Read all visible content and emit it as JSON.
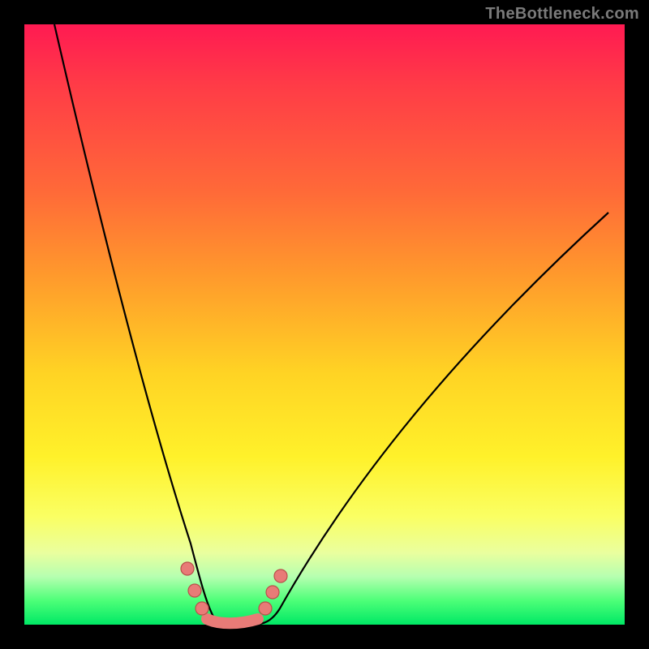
{
  "watermark": "TheBottleneck.com",
  "colors": {
    "page_bg": "#000000",
    "gradient_stops": [
      "#ff1a52",
      "#ff3b47",
      "#ff6a38",
      "#ff9a2c",
      "#ffd324",
      "#fff12a",
      "#faff63",
      "#eaff9e",
      "#b6ffb0",
      "#4dff78",
      "#00e865"
    ],
    "curve_stroke": "#000000",
    "bead_fill": "#e87b77",
    "bead_stroke": "#b94f4a",
    "watermark_text": "#7a7a7a"
  },
  "chart_data": {
    "type": "line",
    "title": "",
    "xlabel": "",
    "ylabel": "",
    "xlim": [
      0,
      100
    ],
    "ylim": [
      0,
      100
    ],
    "grid": false,
    "legend": false,
    "series": [
      {
        "name": "left-branch",
        "x": [
          5,
          8,
          11,
          14,
          17,
          20,
          23,
          25,
          27,
          29,
          31
        ],
        "y": [
          100,
          82,
          66,
          51,
          38,
          27,
          18,
          12,
          7,
          3,
          0
        ]
      },
      {
        "name": "valley-floor",
        "x": [
          31,
          33,
          35,
          37,
          39
        ],
        "y": [
          0,
          0,
          0,
          0,
          0
        ]
      },
      {
        "name": "right-branch",
        "x": [
          39,
          43,
          48,
          54,
          60,
          67,
          74,
          82,
          90,
          97
        ],
        "y": [
          0,
          4,
          10,
          18,
          27,
          36,
          45,
          54,
          62,
          69
        ]
      }
    ],
    "markers": [
      {
        "name": "bead-left-1",
        "x": 27,
        "y": 9
      },
      {
        "name": "bead-left-2",
        "x": 28.5,
        "y": 5
      },
      {
        "name": "bead-left-3",
        "x": 30,
        "y": 2
      },
      {
        "name": "bead-right-1",
        "x": 40,
        "y": 2
      },
      {
        "name": "bead-right-2",
        "x": 41.5,
        "y": 5
      },
      {
        "name": "bead-right-3",
        "x": 43,
        "y": 8
      },
      {
        "name": "valley-segment-start",
        "x": 31,
        "y": 0
      },
      {
        "name": "valley-segment-end",
        "x": 39,
        "y": 0
      }
    ],
    "annotations": []
  }
}
